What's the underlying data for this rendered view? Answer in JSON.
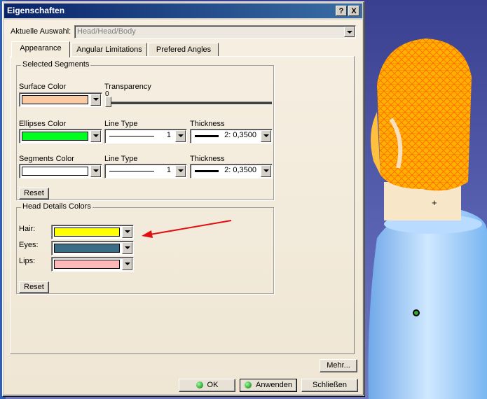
{
  "window": {
    "title": "Eigenschaften",
    "help_label": "?",
    "close_label": "X"
  },
  "selection": {
    "label": "Aktuelle Auswahl:",
    "value": "Head/Head/Body"
  },
  "tabs": [
    {
      "label": "Appearance",
      "active": true
    },
    {
      "label": "Angular Limitations",
      "active": false
    },
    {
      "label": "Prefered Angles",
      "active": false
    }
  ],
  "selected_segments": {
    "title": "Selected Segments",
    "surface_color_label": "Surface Color",
    "surface_color": "#f9caa4",
    "transparency_label": "Transparency",
    "transparency_value": "0",
    "ellipses_color_label": "Ellipses Color",
    "ellipses_color": "#00ff20",
    "line_type_label_1": "Line Type",
    "line_type_value_1": "1",
    "thickness_label_1": "Thickness",
    "thickness_value_1": "2: 0,3500",
    "segments_color_label": "Segments Color",
    "segments_color": "#ffffff",
    "line_type_label_2": "Line Type",
    "line_type_value_2": "1",
    "thickness_label_2": "Thickness",
    "thickness_value_2": "2: 0,3500",
    "reset_label": "Reset"
  },
  "head_details": {
    "title": "Head Details Colors",
    "hair_label": "Hair:",
    "hair_color": "#ffff00",
    "eyes_label": "Eyes:",
    "eyes_color": "#3b6e86",
    "lips_label": "Lips:",
    "lips_color": "#ffb8b8",
    "reset_label": "Reset"
  },
  "footer": {
    "more_label": "Mehr...",
    "ok_label": "OK",
    "apply_label": "Anwenden",
    "close_label": "Schließen"
  },
  "colors": {
    "annotation_arrow": "#e01010",
    "hair_mesh": "#ffb000",
    "shirt": "#a8d4ff",
    "neck": "#f8e6c8"
  }
}
